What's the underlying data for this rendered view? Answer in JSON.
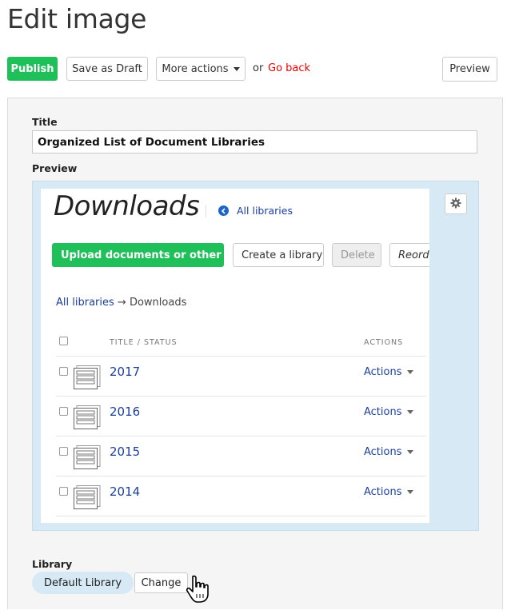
{
  "page": {
    "title": "Edit image"
  },
  "toolbar": {
    "publish": "Publish",
    "save_draft": "Save as Draft",
    "more_actions": "More actions",
    "or": "or",
    "go_back": "Go back",
    "preview": "Preview"
  },
  "form": {
    "title_label": "Title",
    "title_value": "Organized List of Document Libraries",
    "preview_label": "Preview",
    "library_label": "Library",
    "library_value": "Default Library",
    "change_button": "Change"
  },
  "preview_content": {
    "heading": "Downloads",
    "all_libraries_link": "All libraries",
    "buttons": {
      "upload": "Upload documents or other files",
      "create": "Create a library",
      "delete": "Delete",
      "reorder": "Reorder"
    },
    "breadcrumb": {
      "link": "All libraries",
      "arrow": "→",
      "current": "Downloads"
    },
    "table": {
      "col_title": "TITLE / STATUS",
      "col_actions": "ACTIONS",
      "rows": [
        {
          "title": "2017",
          "actions": "Actions"
        },
        {
          "title": "2016",
          "actions": "Actions"
        },
        {
          "title": "2015",
          "actions": "Actions"
        },
        {
          "title": "2014",
          "actions": "Actions"
        }
      ]
    }
  },
  "colors": {
    "green": "#1fbf5a",
    "link_blue": "#1b3fa0",
    "go_back_red": "#ee0000",
    "preview_bg": "#d7e9f5"
  }
}
